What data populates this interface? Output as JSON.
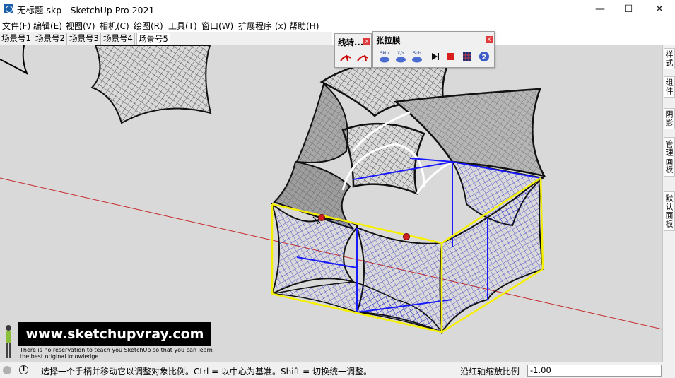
{
  "window": {
    "title": "无标题.skp - SketchUp Pro 2021",
    "minimize_glyph": "—",
    "maximize_glyph": "☐",
    "close_glyph": "✕"
  },
  "menu": [
    "文件(F)",
    "编辑(E)",
    "视图(V)",
    "相机(C)",
    "绘图(R)",
    "工具(T)",
    "窗口(W)",
    "扩展程序 (x)",
    "帮助(H)"
  ],
  "scenes": [
    "场景号1",
    "场景号2",
    "场景号3",
    "场景号4",
    "场景号5"
  ],
  "active_scene": "场景号5",
  "toolwin_line": {
    "title": "线转...",
    "close": "x",
    "buttons": [
      "line-to-tube-icon",
      "tube-refresh-icon"
    ]
  },
  "toolwin_tension": {
    "title": "张拉膜",
    "close": "x",
    "buttons": [
      {
        "label": "Skin",
        "icon": "skin-icon"
      },
      {
        "label": "X/Y",
        "icon": "xy-icon"
      },
      {
        "label": "Sub",
        "icon": "sub-icon"
      },
      {
        "label": "",
        "icon": "play-icon"
      },
      {
        "label": "",
        "icon": "stop-icon"
      },
      {
        "label": "",
        "icon": "grid-icon"
      },
      {
        "label": "",
        "icon": "about-icon"
      }
    ]
  },
  "right_tabs": [
    "样式",
    "组件",
    "阴影",
    "管理面板",
    "默认面板"
  ],
  "watermark": {
    "banner": "www.sketchupvray.com",
    "line1": "There is no reservation to teach you SketchUp so that you can learn",
    "line2": "the best original knowledge."
  },
  "status": {
    "hint": "选择一个手柄并移动它以调整对象比例。Ctrl = 以中心为基准。Shift = 切换统一调整。",
    "measure_label": "沿红轴缩放比例",
    "measure_value": "-1.00"
  },
  "colors": {
    "viewport_bg": "#d9d9d9",
    "red_axis": "#c62828",
    "selection_blue": "#1a1aff",
    "bbox_yellow": "#f5f000"
  }
}
